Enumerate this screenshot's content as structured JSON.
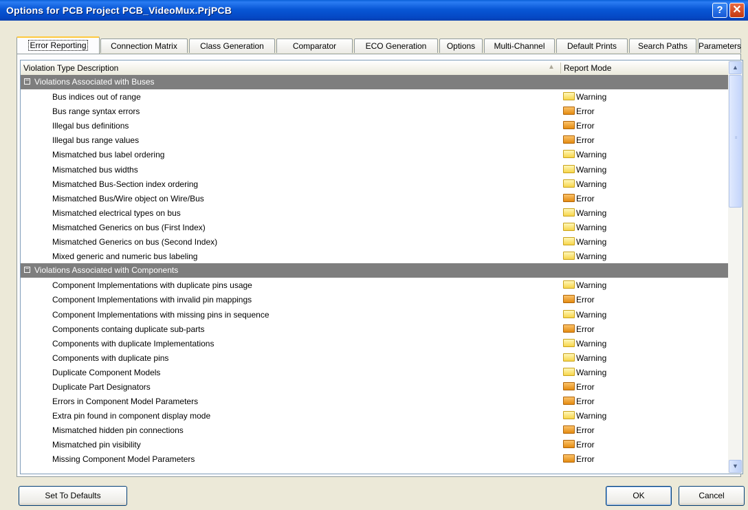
{
  "window": {
    "title": "Options for PCB Project PCB_VideoMux.PrjPCB",
    "help_glyph": "?",
    "close_glyph": "✕"
  },
  "tabs": [
    {
      "label": "Error Reporting",
      "active": true
    },
    {
      "label": "Connection Matrix"
    },
    {
      "label": "Class Generation"
    },
    {
      "label": "Comparator"
    },
    {
      "label": "ECO Generation"
    },
    {
      "label": "Options"
    },
    {
      "label": "Multi-Channel"
    },
    {
      "label": "Default Prints"
    },
    {
      "label": "Search Paths"
    },
    {
      "label": "Parameters"
    }
  ],
  "grid": {
    "columns": {
      "description": "Violation Type Description",
      "mode": "Report Mode",
      "sort_glyph": "▲"
    },
    "groups": [
      {
        "label": "Violations Associated with Buses",
        "expander": "−",
        "rows": [
          {
            "desc": "Bus indices out of range",
            "mode": "Warning"
          },
          {
            "desc": "Bus range syntax errors",
            "mode": "Error"
          },
          {
            "desc": "Illegal bus definitions",
            "mode": "Error"
          },
          {
            "desc": "Illegal bus range values",
            "mode": "Error"
          },
          {
            "desc": "Mismatched bus label ordering",
            "mode": "Warning"
          },
          {
            "desc": "Mismatched bus widths",
            "mode": "Warning"
          },
          {
            "desc": "Mismatched Bus-Section index ordering",
            "mode": "Warning"
          },
          {
            "desc": "Mismatched Bus/Wire object on Wire/Bus",
            "mode": "Error"
          },
          {
            "desc": "Mismatched electrical types on bus",
            "mode": "Warning"
          },
          {
            "desc": "Mismatched Generics on bus (First Index)",
            "mode": "Warning"
          },
          {
            "desc": "Mismatched Generics on bus (Second Index)",
            "mode": "Warning"
          },
          {
            "desc": "Mixed generic and numeric bus labeling",
            "mode": "Warning"
          }
        ]
      },
      {
        "label": "Violations Associated with Components",
        "expander": "−",
        "rows": [
          {
            "desc": "Component Implementations with duplicate pins usage",
            "mode": "Warning"
          },
          {
            "desc": "Component Implementations with invalid pin mappings",
            "mode": "Error"
          },
          {
            "desc": "Component Implementations with missing pins in sequence",
            "mode": "Warning"
          },
          {
            "desc": "Components containg duplicate sub-parts",
            "mode": "Error"
          },
          {
            "desc": "Components with duplicate Implementations",
            "mode": "Warning"
          },
          {
            "desc": "Components with duplicate pins",
            "mode": "Warning"
          },
          {
            "desc": "Duplicate Component Models",
            "mode": "Warning"
          },
          {
            "desc": "Duplicate Part Designators",
            "mode": "Error"
          },
          {
            "desc": "Errors in Component Model Parameters",
            "mode": "Error"
          },
          {
            "desc": "Extra pin found in component display mode",
            "mode": "Warning"
          },
          {
            "desc": "Mismatched hidden pin connections",
            "mode": "Error"
          },
          {
            "desc": "Mismatched pin visibility",
            "mode": "Error"
          },
          {
            "desc": "Missing Component Model Parameters",
            "mode": "Error"
          }
        ]
      }
    ]
  },
  "scrollbar": {
    "up_glyph": "▲",
    "down_glyph": "▼",
    "grip": "≡"
  },
  "buttons": {
    "defaults": "Set To Defaults",
    "ok": "OK",
    "cancel": "Cancel"
  },
  "colors": {
    "group_header": "#7e7e7e",
    "titlebar": "#0857d6",
    "warning_folder": "#f7d54b",
    "error_folder": "#e48c12"
  }
}
